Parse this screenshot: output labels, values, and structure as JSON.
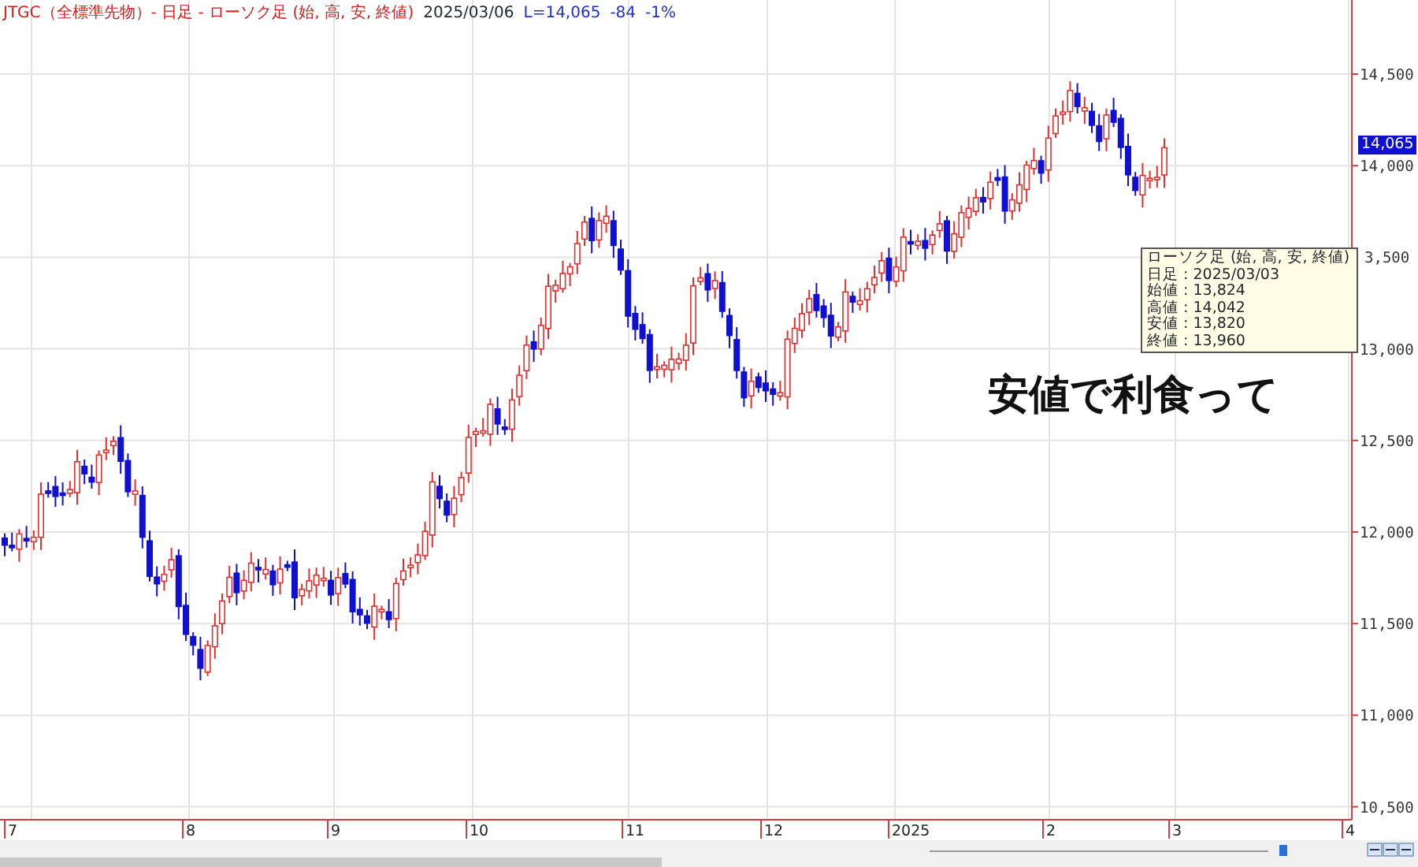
{
  "header": {
    "title": "JTGC（全標準先物）- 日足 - ローソク足 (始, 高, 安, 終値)",
    "date": "2025/03/06",
    "last": "L=14,065",
    "change": "-84",
    "change_pct": "-1%"
  },
  "chart": {
    "kind": "candlestick",
    "y_ticks": [
      "14,500",
      "14,000",
      "3,500",
      "13,000",
      "12,500",
      "12,000",
      "11,500",
      "11,000",
      "10,500"
    ],
    "x_labels": [
      "7",
      "8",
      "9",
      "10",
      "11",
      "12",
      "2025",
      "2",
      "3",
      "4"
    ],
    "price_tag": "14,065",
    "tooltip": {
      "title": "ローソク足 (始, 高, 安, 終値)",
      "rows": [
        "日足 : 2025/03/03",
        "始値 : 13,824",
        "高値 : 14,042",
        "安値 : 13,820",
        "終値 : 13,960"
      ]
    }
  },
  "annotation": "安値で利食って"
}
